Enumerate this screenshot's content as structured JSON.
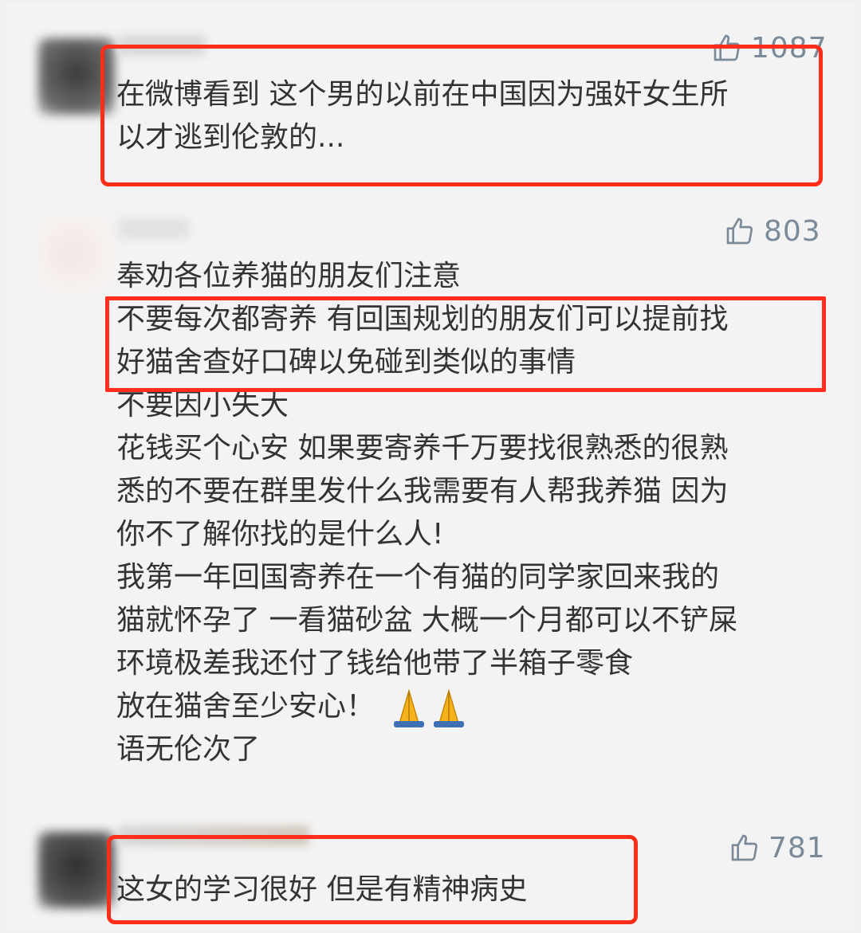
{
  "comments": [
    {
      "likes": "1087",
      "lines": [
        "在微博看到 这个男的以前在中国因为强奸女生所",
        "以才逃到伦敦的..."
      ]
    },
    {
      "likes": "803",
      "lines": [
        "奉劝各位养猫的朋友们注意",
        "不要每次都寄养 有回国规划的朋友们可以提前找",
        "好猫舍查好口碑以免碰到类似的事情",
        "不要因小失大",
        "花钱买个心安 如果要寄养千万要找很熟悉的很熟",
        "悉的不要在群里发什么我需要有人帮我养猫 因为",
        "你不了解你找的是什么人!",
        "我第一年回国寄养在一个有猫的同学家回来我的",
        "猫就怀孕了 一看猫砂盆 大概一个月都可以不铲屎",
        "环境极差我还付了钱给他带了半箱子零食",
        "放在猫舍至少安心！",
        "语无伦次了"
      ],
      "emoji": "folded-hands-emoji"
    },
    {
      "likes": "781",
      "lines": [
        "这女的学习很好 但是有精神病史"
      ]
    }
  ],
  "icons": {
    "like": "thumbs-up-icon"
  },
  "colors": {
    "highlight": "#ff2d1a",
    "like": "#7a8a99",
    "text": "#333333"
  }
}
